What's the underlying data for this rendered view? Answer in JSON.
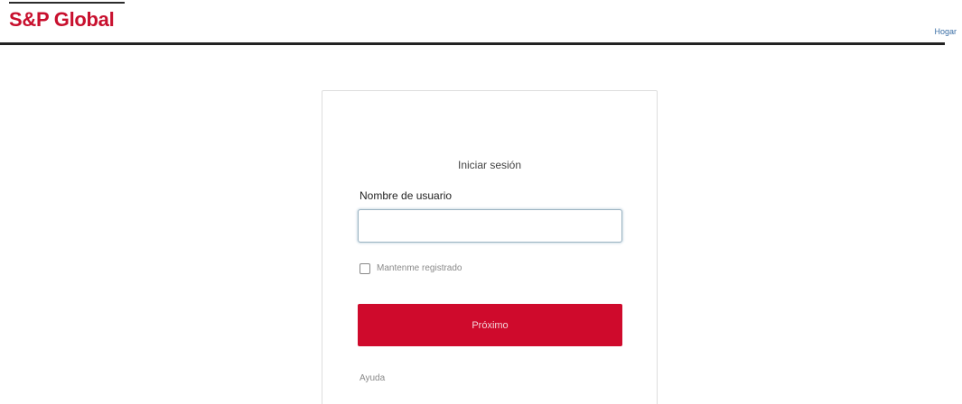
{
  "header": {
    "logo_text": "S&P Global",
    "home_link": "Hogar"
  },
  "login": {
    "title": "Iniciar sesión",
    "username_label": "Nombre de usuario",
    "username_value": "",
    "remember_label": "Mantenme registrado",
    "remember_checked": false,
    "next_label": "Próximo",
    "help_link": "Ayuda"
  },
  "colors": {
    "brand_red": "#cf0a2c",
    "logo_red": "#c8102e",
    "link_blue": "#3a6ea5"
  }
}
